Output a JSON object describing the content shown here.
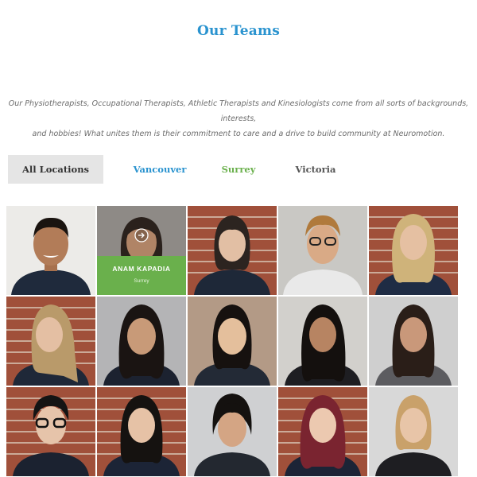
{
  "page": {
    "title": "Our Teams",
    "intro_line1": "Our Physiotherapists, Occupational Therapists, Athletic Therapists and Kinesiologists come from all sorts of backgrounds, interests,",
    "intro_line2": "and hobbies! What unites them is their commitment to care and a drive to build community at Neuromotion."
  },
  "filters": [
    {
      "label": "All Locations",
      "color": "#333333",
      "active": true
    },
    {
      "label": "Vancouver",
      "color": "#2a93cf",
      "active": false
    },
    {
      "label": "Surrey",
      "color": "#6ab04c",
      "active": false
    },
    {
      "label": "Victoria",
      "color": "#555555",
      "active": false
    }
  ],
  "hovered_member": {
    "name": "ANAM KAPADIA",
    "location": "Surrey"
  },
  "colors": {
    "accent_blue": "#2a93cf",
    "accent_green": "#6ab04c",
    "brick": "#a0503a"
  },
  "icons": {
    "view": "arrow-circle-icon"
  }
}
